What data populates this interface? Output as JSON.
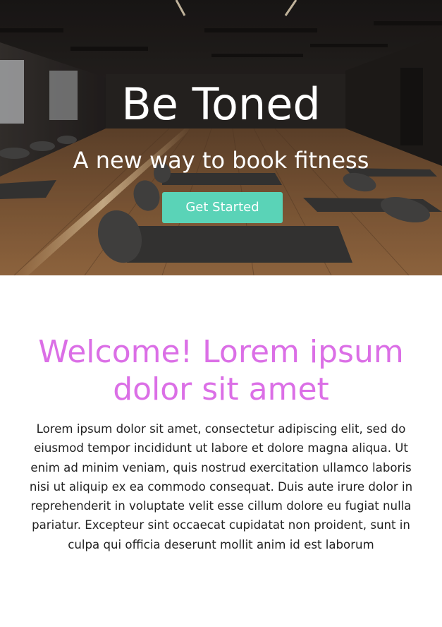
{
  "hero": {
    "title": "Be Toned",
    "subtitle": "A new way to book fitness",
    "cta_label": "Get Started",
    "cta_color": "#5ad3b7"
  },
  "welcome": {
    "heading": "Welcome! Lorem ipsum dolor sit amet",
    "heading_color": "#db6fe6",
    "body": "Lorem ipsum dolor sit amet, consectetur adipiscing elit, sed do eiusmod tempor incididunt ut labore et dolore magna aliqua. Ut enim ad minim veniam, quis nostrud exercitation ullamco laboris nisi ut aliquip ex ea commodo consequat. Duis aute irure dolor in reprehenderit in voluptate velit esse cillum dolore eu fugiat nulla pariatur. Excepteur sint occaecat cupidatat non proident, sunt in culpa qui officia deserunt mollit anim id est laborum"
  }
}
